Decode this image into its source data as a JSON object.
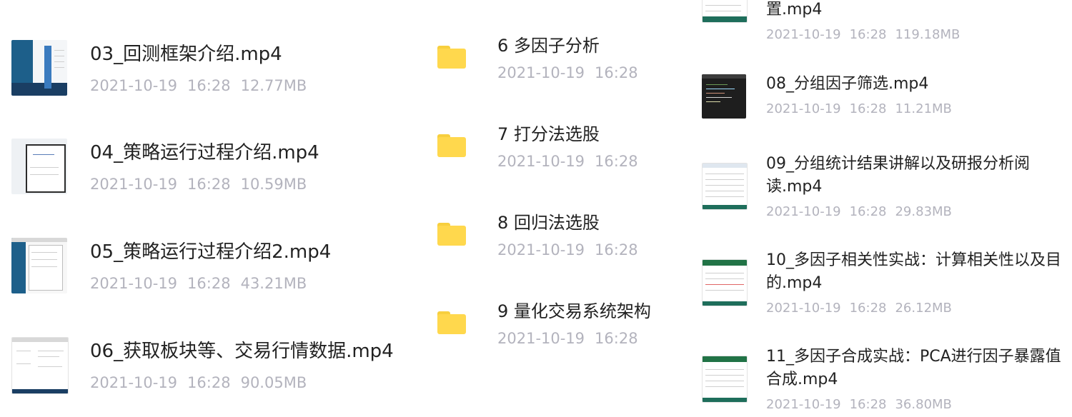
{
  "left_files": [
    {
      "name": "03_回测框架介绍.mp4",
      "date": "2021-10-19",
      "time": "16:28",
      "size": "12.77MB",
      "thumb": "desktop"
    },
    {
      "name": "04_策略运行过程介绍.mp4",
      "date": "2021-10-19",
      "time": "16:28",
      "size": "10.59MB",
      "thumb": "login-dialog"
    },
    {
      "name": "05_策略运行过程介绍2.mp4",
      "date": "2021-10-19",
      "time": "16:28",
      "size": "43.21MB",
      "thumb": "desktop-doc"
    },
    {
      "name": "06_获取板块等、交易行情数据.mp4",
      "date": "2021-10-19",
      "time": "16:28",
      "size": "90.05MB",
      "thumb": "document"
    }
  ],
  "folders": [
    {
      "name": "6 多因子分析",
      "date": "2021-10-19",
      "time": "16:28",
      "icon": "folder-icon"
    },
    {
      "name": "7 打分法选股",
      "date": "2021-10-19",
      "time": "16:28",
      "icon": "folder-icon"
    },
    {
      "name": "8 回归法选股",
      "date": "2021-10-19",
      "time": "16:28",
      "icon": "folder-icon"
    },
    {
      "name": "9 量化交易系统架构",
      "date": "2021-10-19",
      "time": "16:28",
      "icon": "folder-icon"
    }
  ],
  "right_files": [
    {
      "name_lines": [
        "置.mp4"
      ],
      "date": "2021-10-19",
      "time": "16:28",
      "size": "119.18MB",
      "thumb": "spreadsheet"
    },
    {
      "name_lines": [
        "08_分组因子筛选.mp4"
      ],
      "date": "2021-10-19",
      "time": "16:28",
      "size": "11.21MB",
      "thumb": "code-editor"
    },
    {
      "name_lines": [
        "09_分组统计结果讲解以及研报分析阅",
        "读.mp4"
      ],
      "date": "2021-10-19",
      "time": "16:28",
      "size": "29.83MB",
      "thumb": "spreadsheet"
    },
    {
      "name_lines": [
        "10_多因子相关性实战：计算相关性以及目",
        "的.mp4"
      ],
      "date": "2021-10-19",
      "time": "16:28",
      "size": "26.12MB",
      "thumb": "excel"
    },
    {
      "name_lines": [
        "11_多因子合成实战：PCA进行因子暴露值",
        "合成.mp4"
      ],
      "date": "2021-10-19",
      "time": "16:28",
      "size": "36.80MB",
      "thumb": "excel"
    }
  ],
  "colors": {
    "folder": "#ffd84d",
    "meta_text": "#b3b3bd",
    "title_text": "#222222"
  }
}
